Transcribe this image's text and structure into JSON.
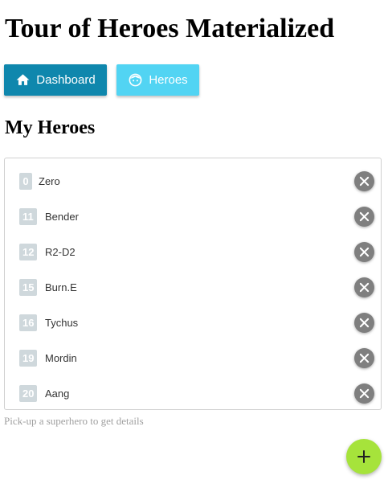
{
  "app": {
    "title": "Tour of Heroes Materialized"
  },
  "nav": {
    "dashboard": {
      "label": "Dashboard",
      "icon": "home-icon",
      "color": "#0f87ad"
    },
    "heroes": {
      "label": "Heroes",
      "icon": "face-icon",
      "color": "#52d4f3"
    }
  },
  "page": {
    "title": "My Heroes",
    "hint": "Pick-up a superhero to get details"
  },
  "heroes": [
    {
      "id": "0",
      "name": "Zero"
    },
    {
      "id": "11",
      "name": "Bender"
    },
    {
      "id": "12",
      "name": "R2-D2"
    },
    {
      "id": "15",
      "name": "Burn.E"
    },
    {
      "id": "16",
      "name": "Tychus"
    },
    {
      "id": "19",
      "name": "Mordin"
    },
    {
      "id": "20",
      "name": "Aang"
    }
  ],
  "actions": {
    "delete_icon": "close-icon",
    "add_icon": "plus-icon",
    "add_color": "#a6e33b"
  }
}
